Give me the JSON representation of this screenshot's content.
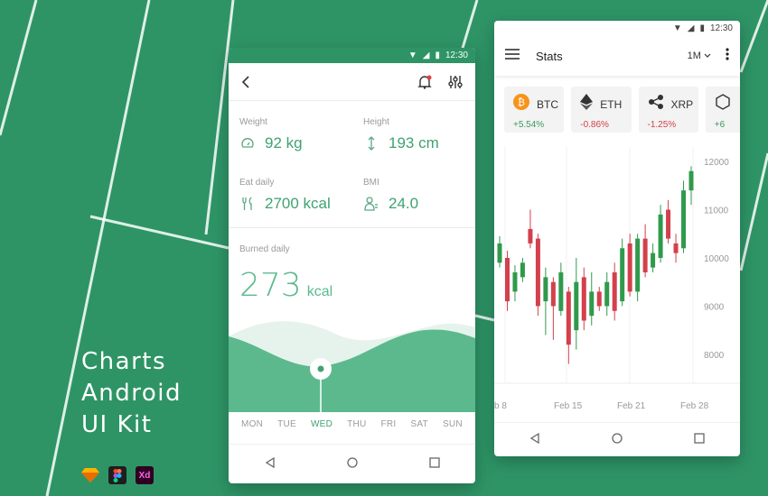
{
  "headline": [
    "Charts",
    "Android",
    "UI Kit"
  ],
  "tools": [
    {
      "icon": "sketch-icon",
      "label": ""
    },
    {
      "icon": "figma-icon",
      "label": ""
    },
    {
      "icon": "xd-icon",
      "label": "Xd"
    }
  ],
  "phone1": {
    "time": "12:30",
    "metrics": [
      {
        "label": "Weight",
        "value": "92 kg",
        "icon": "gauge-icon"
      },
      {
        "label": "Height",
        "value": "193 cm",
        "icon": "height-arrow-icon"
      },
      {
        "label": "Eat daily",
        "value": "2700 kcal",
        "icon": "cutlery-icon"
      },
      {
        "label": "BMI",
        "value": "24.0",
        "icon": "person-icon"
      }
    ],
    "burned_label": "Burned daily",
    "burned_value": "273",
    "burned_unit": "kcal",
    "days": [
      "MON",
      "TUE",
      "WED",
      "THU",
      "FRI",
      "SAT",
      "SUN"
    ],
    "active_day": "WED",
    "accent": "#3fa271"
  },
  "phone2": {
    "time": "12:30",
    "title": "Stats",
    "range": "1M",
    "coins": [
      {
        "symbol": "BTC",
        "change": "+5.54%",
        "dir": "up",
        "icon": "bitcoin-icon"
      },
      {
        "symbol": "ETH",
        "change": "-0.86%",
        "dir": "down",
        "icon": "ethereum-icon"
      },
      {
        "symbol": "XRP",
        "change": "-1.25%",
        "dir": "down",
        "icon": "ripple-icon"
      },
      {
        "symbol": "",
        "change": "+6",
        "dir": "up",
        "icon": "coin-icon"
      }
    ],
    "chart_data": {
      "type": "candlestick",
      "y_ticks": [
        "12000",
        "11000",
        "10000",
        "9000",
        "8000"
      ],
      "ylim": [
        7400,
        12300
      ],
      "x_ticks": [
        "b 8",
        "Feb 15",
        "Feb 21",
        "Feb 28"
      ],
      "candles": [
        {
          "o": 9900,
          "c": 10300,
          "h": 10450,
          "l": 9800
        },
        {
          "o": 10000,
          "c": 9100,
          "h": 10150,
          "l": 8900
        },
        {
          "o": 9300,
          "c": 9700,
          "h": 9850,
          "l": 9100
        },
        {
          "o": 9600,
          "c": 9900,
          "h": 10000,
          "l": 9500
        },
        {
          "o": 10600,
          "c": 10300,
          "h": 11000,
          "l": 10200
        },
        {
          "o": 10400,
          "c": 9000,
          "h": 10500,
          "l": 8800
        },
        {
          "o": 9100,
          "c": 9600,
          "h": 9800,
          "l": 8400
        },
        {
          "o": 9500,
          "c": 9000,
          "h": 9600,
          "l": 8300
        },
        {
          "o": 8900,
          "c": 9700,
          "h": 9900,
          "l": 8800
        },
        {
          "o": 9300,
          "c": 8200,
          "h": 9400,
          "l": 7800
        },
        {
          "o": 8500,
          "c": 9500,
          "h": 10000,
          "l": 8100
        },
        {
          "o": 9600,
          "c": 8700,
          "h": 9800,
          "l": 8500
        },
        {
          "o": 8800,
          "c": 9300,
          "h": 9700,
          "l": 8600
        },
        {
          "o": 9300,
          "c": 9000,
          "h": 9400,
          "l": 8900
        },
        {
          "o": 9000,
          "c": 9500,
          "h": 9700,
          "l": 8800
        },
        {
          "o": 9700,
          "c": 8900,
          "h": 9900,
          "l": 8700
        },
        {
          "o": 9100,
          "c": 10200,
          "h": 10400,
          "l": 9000
        },
        {
          "o": 10300,
          "c": 9300,
          "h": 10500,
          "l": 9200
        },
        {
          "o": 9300,
          "c": 10400,
          "h": 10500,
          "l": 9100
        },
        {
          "o": 10400,
          "c": 9700,
          "h": 10700,
          "l": 9600
        },
        {
          "o": 9800,
          "c": 10100,
          "h": 10300,
          "l": 9700
        },
        {
          "o": 10000,
          "c": 10900,
          "h": 11100,
          "l": 9900
        },
        {
          "o": 11000,
          "c": 10400,
          "h": 11200,
          "l": 10300
        },
        {
          "o": 10300,
          "c": 10100,
          "h": 10500,
          "l": 9900
        },
        {
          "o": 10200,
          "c": 11400,
          "h": 11600,
          "l": 10100
        },
        {
          "o": 11400,
          "c": 11800,
          "h": 11900,
          "l": 11100
        }
      ],
      "up_color": "#2f9a4c",
      "down_color": "#d3404b"
    }
  }
}
